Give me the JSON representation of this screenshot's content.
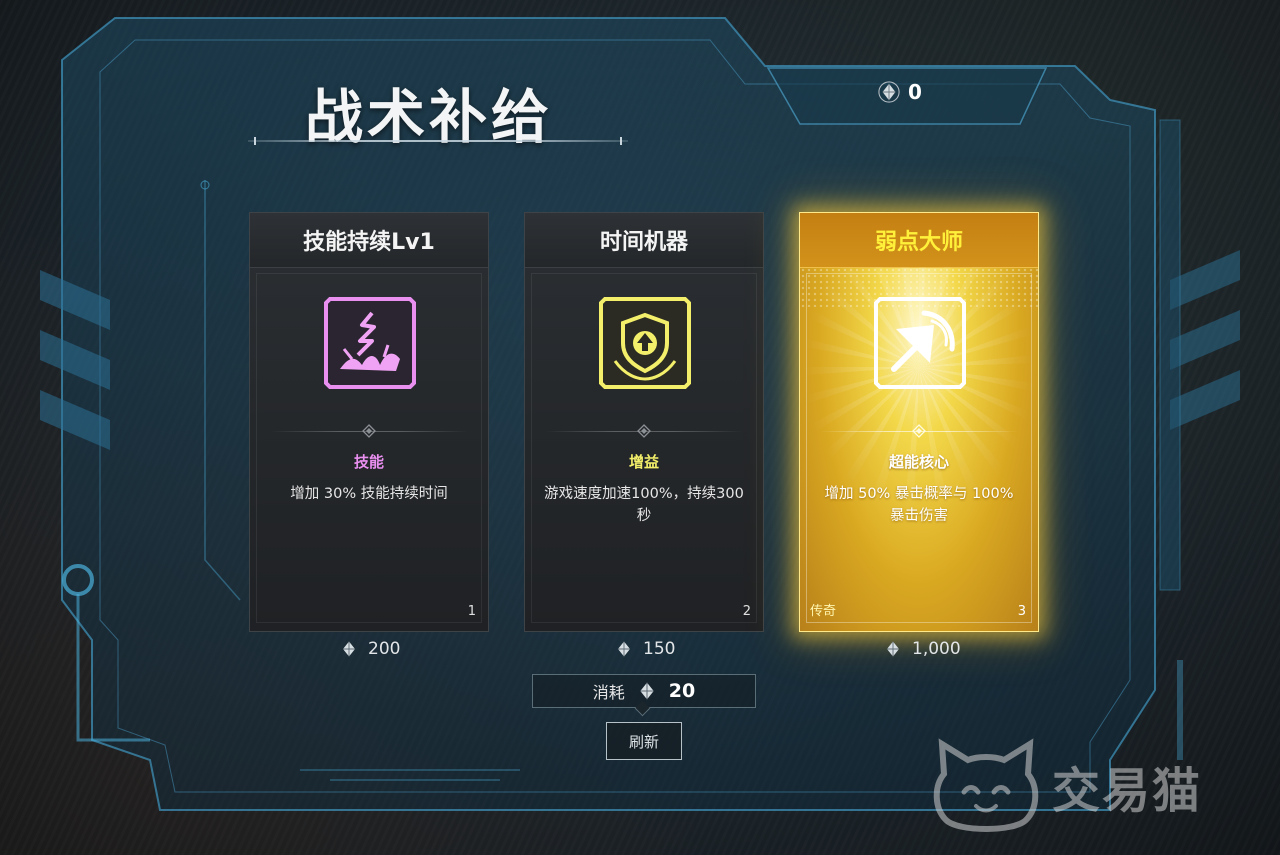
{
  "title": "战术补给",
  "currency": {
    "icon": "gem-icon",
    "amount": "0"
  },
  "cards": [
    {
      "name": "技能持续Lv1",
      "icon": "skill-wave-icon",
      "type_label": "技能",
      "type_color": "#e98ff0",
      "description": "增加 30% 技能持续时间",
      "index": "1",
      "rarity": "",
      "price": "200"
    },
    {
      "name": "时间机器",
      "icon": "shield-arrow-icon",
      "type_label": "增益",
      "type_color": "#f3ef6a",
      "description": "游戏速度加速100%，持续300秒",
      "index": "2",
      "rarity": "",
      "price": "150"
    },
    {
      "name": "弱点大师",
      "icon": "strike-arrow-icon",
      "type_label": "超能核心",
      "type_color": "#ffffff",
      "description": "增加 50% 暴击概率与 100% 暴击伤害",
      "index": "3",
      "rarity": "传奇",
      "price": "1,000"
    }
  ],
  "refresh_cost": {
    "label": "消耗",
    "value": "20"
  },
  "refresh_button": "刷新",
  "watermark": "交易猫"
}
